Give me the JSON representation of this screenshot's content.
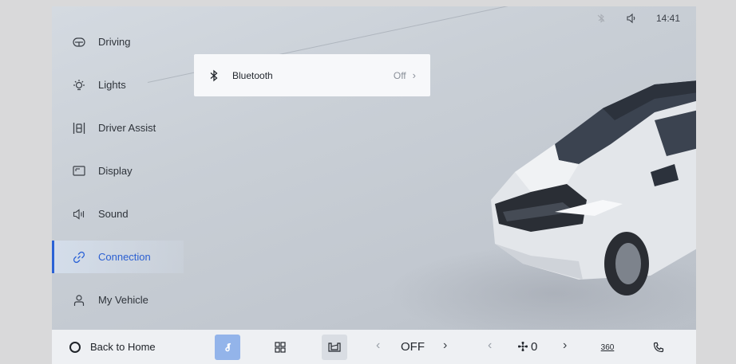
{
  "status_bar": {
    "icons": [
      "bluetooth-off-icon",
      "volume-icon"
    ],
    "time": "14:41"
  },
  "sidebar": {
    "items": [
      {
        "label": "Driving",
        "icon": "steering-wheel-icon",
        "active": false
      },
      {
        "label": "Lights",
        "icon": "light-bulb-icon",
        "active": false
      },
      {
        "label": "Driver Assist",
        "icon": "driver-assist-icon",
        "active": false
      },
      {
        "label": "Display",
        "icon": "display-icon",
        "active": false
      },
      {
        "label": "Sound",
        "icon": "speaker-icon",
        "active": false
      },
      {
        "label": "Connection",
        "icon": "link-icon",
        "active": true
      },
      {
        "label": "My Vehicle",
        "icon": "person-icon",
        "active": false
      }
    ]
  },
  "connection_panel": {
    "bluetooth": {
      "label": "Bluetooth",
      "value": "Off",
      "icon": "bluetooth-icon"
    }
  },
  "dock": {
    "home_label": "Back to Home",
    "ac_label": "OFF",
    "fan_value": "0",
    "camera_label": "360",
    "icons": [
      "home-circle-icon",
      "music-icon",
      "apps-grid-icon",
      "car-seat-icon",
      "fan-icon",
      "camera-360-icon",
      "phone-icon"
    ]
  },
  "colors": {
    "accent": "#2b62d6",
    "music_tile": "#93b4ea",
    "panel": "#f7f8fa",
    "dock": "#eef0f3"
  }
}
